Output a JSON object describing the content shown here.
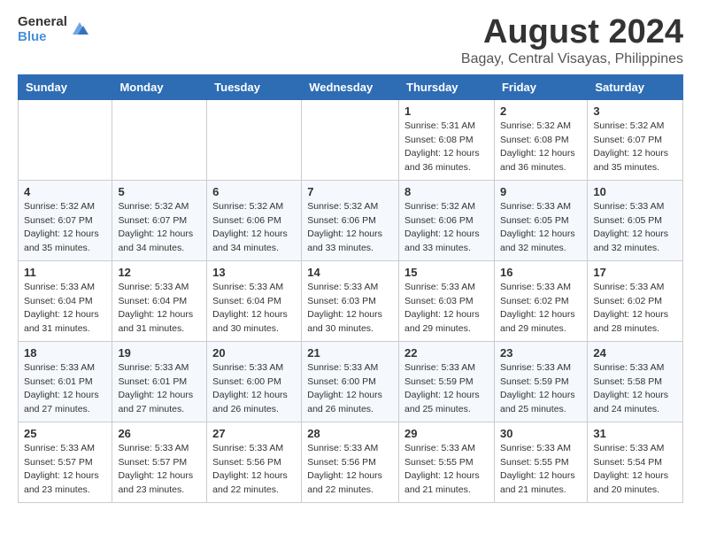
{
  "header": {
    "logo_general": "General",
    "logo_blue": "Blue",
    "month_title": "August 2024",
    "location": "Bagay, Central Visayas, Philippines"
  },
  "weekdays": [
    "Sunday",
    "Monday",
    "Tuesday",
    "Wednesday",
    "Thursday",
    "Friday",
    "Saturday"
  ],
  "weeks": [
    [
      {
        "day": "",
        "info": ""
      },
      {
        "day": "",
        "info": ""
      },
      {
        "day": "",
        "info": ""
      },
      {
        "day": "",
        "info": ""
      },
      {
        "day": "1",
        "info": "Sunrise: 5:31 AM\nSunset: 6:08 PM\nDaylight: 12 hours\nand 36 minutes."
      },
      {
        "day": "2",
        "info": "Sunrise: 5:32 AM\nSunset: 6:08 PM\nDaylight: 12 hours\nand 36 minutes."
      },
      {
        "day": "3",
        "info": "Sunrise: 5:32 AM\nSunset: 6:07 PM\nDaylight: 12 hours\nand 35 minutes."
      }
    ],
    [
      {
        "day": "4",
        "info": "Sunrise: 5:32 AM\nSunset: 6:07 PM\nDaylight: 12 hours\nand 35 minutes."
      },
      {
        "day": "5",
        "info": "Sunrise: 5:32 AM\nSunset: 6:07 PM\nDaylight: 12 hours\nand 34 minutes."
      },
      {
        "day": "6",
        "info": "Sunrise: 5:32 AM\nSunset: 6:06 PM\nDaylight: 12 hours\nand 34 minutes."
      },
      {
        "day": "7",
        "info": "Sunrise: 5:32 AM\nSunset: 6:06 PM\nDaylight: 12 hours\nand 33 minutes."
      },
      {
        "day": "8",
        "info": "Sunrise: 5:32 AM\nSunset: 6:06 PM\nDaylight: 12 hours\nand 33 minutes."
      },
      {
        "day": "9",
        "info": "Sunrise: 5:33 AM\nSunset: 6:05 PM\nDaylight: 12 hours\nand 32 minutes."
      },
      {
        "day": "10",
        "info": "Sunrise: 5:33 AM\nSunset: 6:05 PM\nDaylight: 12 hours\nand 32 minutes."
      }
    ],
    [
      {
        "day": "11",
        "info": "Sunrise: 5:33 AM\nSunset: 6:04 PM\nDaylight: 12 hours\nand 31 minutes."
      },
      {
        "day": "12",
        "info": "Sunrise: 5:33 AM\nSunset: 6:04 PM\nDaylight: 12 hours\nand 31 minutes."
      },
      {
        "day": "13",
        "info": "Sunrise: 5:33 AM\nSunset: 6:04 PM\nDaylight: 12 hours\nand 30 minutes."
      },
      {
        "day": "14",
        "info": "Sunrise: 5:33 AM\nSunset: 6:03 PM\nDaylight: 12 hours\nand 30 minutes."
      },
      {
        "day": "15",
        "info": "Sunrise: 5:33 AM\nSunset: 6:03 PM\nDaylight: 12 hours\nand 29 minutes."
      },
      {
        "day": "16",
        "info": "Sunrise: 5:33 AM\nSunset: 6:02 PM\nDaylight: 12 hours\nand 29 minutes."
      },
      {
        "day": "17",
        "info": "Sunrise: 5:33 AM\nSunset: 6:02 PM\nDaylight: 12 hours\nand 28 minutes."
      }
    ],
    [
      {
        "day": "18",
        "info": "Sunrise: 5:33 AM\nSunset: 6:01 PM\nDaylight: 12 hours\nand 27 minutes."
      },
      {
        "day": "19",
        "info": "Sunrise: 5:33 AM\nSunset: 6:01 PM\nDaylight: 12 hours\nand 27 minutes."
      },
      {
        "day": "20",
        "info": "Sunrise: 5:33 AM\nSunset: 6:00 PM\nDaylight: 12 hours\nand 26 minutes."
      },
      {
        "day": "21",
        "info": "Sunrise: 5:33 AM\nSunset: 6:00 PM\nDaylight: 12 hours\nand 26 minutes."
      },
      {
        "day": "22",
        "info": "Sunrise: 5:33 AM\nSunset: 5:59 PM\nDaylight: 12 hours\nand 25 minutes."
      },
      {
        "day": "23",
        "info": "Sunrise: 5:33 AM\nSunset: 5:59 PM\nDaylight: 12 hours\nand 25 minutes."
      },
      {
        "day": "24",
        "info": "Sunrise: 5:33 AM\nSunset: 5:58 PM\nDaylight: 12 hours\nand 24 minutes."
      }
    ],
    [
      {
        "day": "25",
        "info": "Sunrise: 5:33 AM\nSunset: 5:57 PM\nDaylight: 12 hours\nand 23 minutes."
      },
      {
        "day": "26",
        "info": "Sunrise: 5:33 AM\nSunset: 5:57 PM\nDaylight: 12 hours\nand 23 minutes."
      },
      {
        "day": "27",
        "info": "Sunrise: 5:33 AM\nSunset: 5:56 PM\nDaylight: 12 hours\nand 22 minutes."
      },
      {
        "day": "28",
        "info": "Sunrise: 5:33 AM\nSunset: 5:56 PM\nDaylight: 12 hours\nand 22 minutes."
      },
      {
        "day": "29",
        "info": "Sunrise: 5:33 AM\nSunset: 5:55 PM\nDaylight: 12 hours\nand 21 minutes."
      },
      {
        "day": "30",
        "info": "Sunrise: 5:33 AM\nSunset: 5:55 PM\nDaylight: 12 hours\nand 21 minutes."
      },
      {
        "day": "31",
        "info": "Sunrise: 5:33 AM\nSunset: 5:54 PM\nDaylight: 12 hours\nand 20 minutes."
      }
    ]
  ]
}
